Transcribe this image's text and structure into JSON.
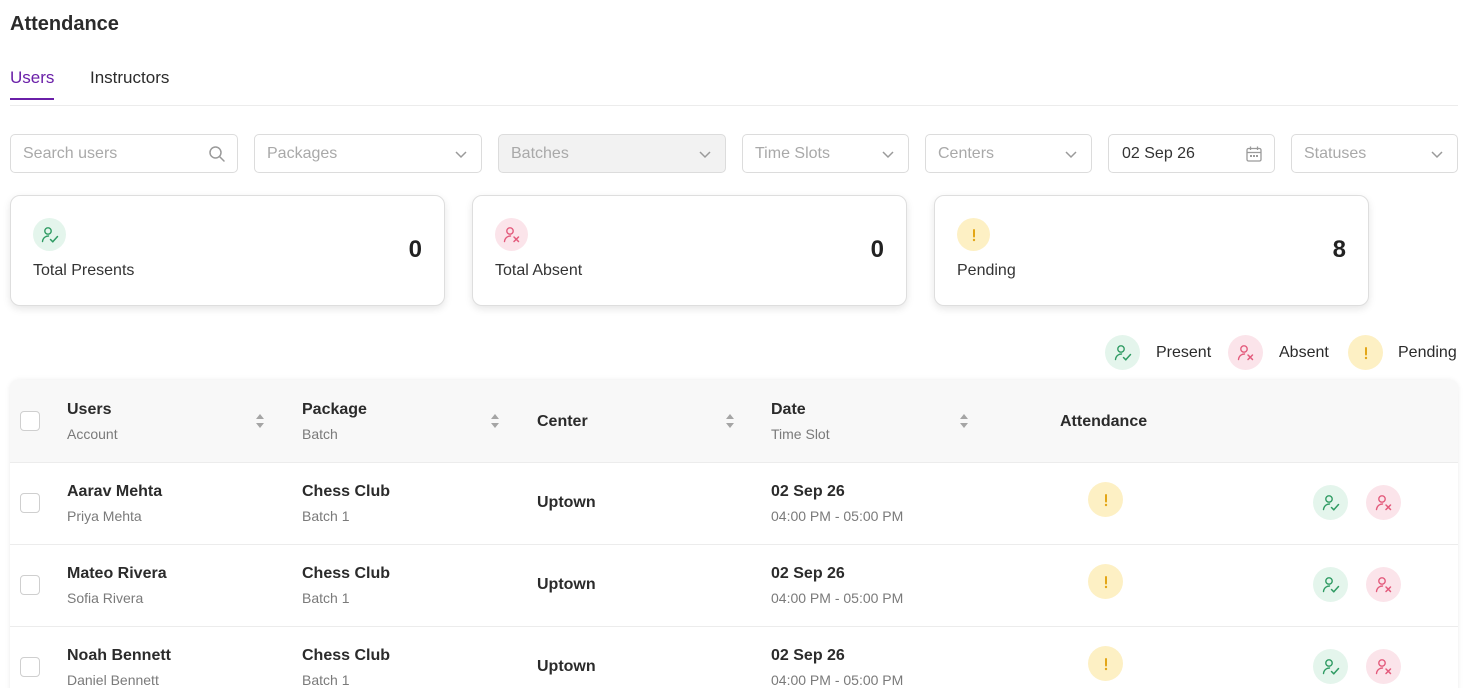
{
  "page": {
    "title": "Attendance"
  },
  "tabs": [
    {
      "label": "Users",
      "active": true
    },
    {
      "label": "Instructors",
      "active": false
    }
  ],
  "filters": {
    "search_placeholder": "Search users",
    "packages_placeholder": "Packages",
    "batches_placeholder": "Batches",
    "time_slots_placeholder": "Time Slots",
    "centers_placeholder": "Centers",
    "date_value": "02 Sep 26",
    "statuses_placeholder": "Statuses"
  },
  "cards": [
    {
      "label": "Total Presents",
      "value": "0",
      "icon": "user-check-icon"
    },
    {
      "label": "Total Absent",
      "value": "0",
      "icon": "user-x-icon"
    },
    {
      "label": "Pending",
      "value": "8",
      "icon": "exclamation-icon"
    }
  ],
  "legend": [
    {
      "label": "Present",
      "icon": "user-check-icon"
    },
    {
      "label": "Absent",
      "icon": "user-x-icon"
    },
    {
      "label": "Pending",
      "icon": "exclamation-icon"
    }
  ],
  "table": {
    "headers": {
      "users": "Users",
      "users_sub": "Account",
      "package": "Package",
      "package_sub": "Batch",
      "center": "Center",
      "date": "Date",
      "date_sub": "Time Slot",
      "attendance": "Attendance"
    },
    "rows": [
      {
        "name": "Aarav Mehta",
        "account": "Priya Mehta",
        "package": "Chess Club",
        "batch": "Batch 1",
        "center": "Uptown",
        "date": "02 Sep 26",
        "time_slot": "04:00 PM - 05:00 PM",
        "status": "pending"
      },
      {
        "name": "Mateo Rivera",
        "account": "Sofia Rivera",
        "package": "Chess Club",
        "batch": "Batch 1",
        "center": "Uptown",
        "date": "02 Sep 26",
        "time_slot": "04:00 PM - 05:00 PM",
        "status": "pending"
      },
      {
        "name": "Noah Bennett",
        "account": "Daniel Bennett",
        "package": "Chess Club",
        "batch": "Batch 1",
        "center": "Uptown",
        "date": "02 Sep 26",
        "time_slot": "04:00 PM - 05:00 PM",
        "status": "pending"
      }
    ]
  },
  "colors": {
    "accent": "#6a1fa8",
    "present": "#2f9b63",
    "present_bg": "#e4f5ec",
    "absent": "#e35b7c",
    "absent_bg": "#fbe4ea",
    "pending": "#e3a617",
    "pending_bg": "#fdf0c4"
  }
}
